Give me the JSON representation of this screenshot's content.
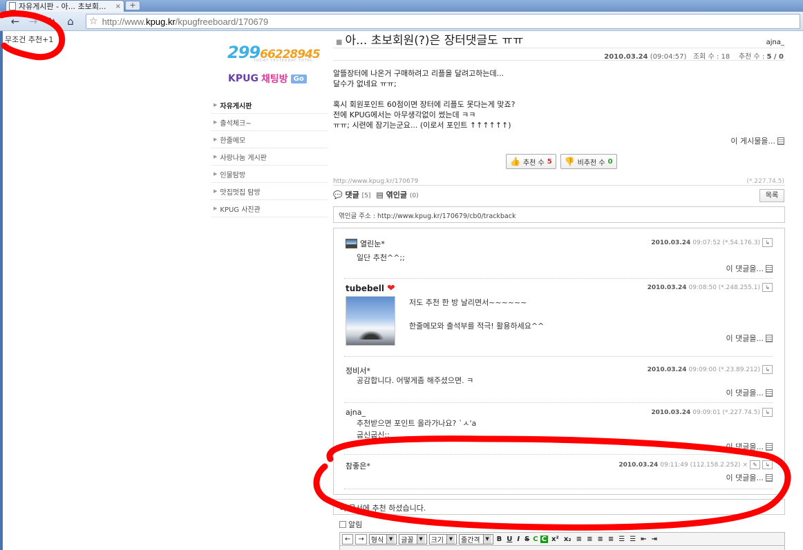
{
  "browser": {
    "tab_title": "자유게시판 - 아... 초보회...",
    "tab_close": "×",
    "new_tab": "+",
    "url_prefix": "http://www.",
    "url_domain": "kpug.kr",
    "url_path": "/kpugfreeboard/170679",
    "back_icon": "←",
    "forward_icon": "→",
    "reload_icon": "↻",
    "home_icon": "⌂",
    "star_icon": "☆"
  },
  "corner_note": "무조건 추천+1",
  "sidebar": {
    "counter_today": "299",
    "counter_rest": "66228945",
    "counter_caption": "TODAY YESTERDAY TOTAL",
    "chat_kpug": "KPUG",
    "chat_room": "채팅방",
    "chat_go": "Go",
    "items": [
      {
        "label": "자유게시판"
      },
      {
        "label": "출석체크~"
      },
      {
        "label": "한줄메모"
      },
      {
        "label": "사랑나눔 게시판"
      },
      {
        "label": "인물탐방"
      },
      {
        "label": "맛집멋집 탐방"
      },
      {
        "label": "KPUG 사진관"
      }
    ]
  },
  "post": {
    "title": "아... 초보회원(?)은 장터댓글도 ㅠㅠ",
    "author": "ajna_",
    "date": "2010.03.24",
    "time": "(09:04:57)",
    "views_label": "조회 수 : ",
    "views": "18",
    "votes_label": "추천 수 : ",
    "votes": "5 / 0",
    "body": [
      "알뜰장터에 나온거 구매하려고 리플을 달려고하는데...",
      "달수가 없네요 ㅠㅠ;",
      "",
      "혹시 회원포인트 60점이면 장터에 리플도 못다는게 맞죠?",
      "전에 KPUG에서는 아무생각없이 썼는데 ㅋㅋ",
      "ㅠㅠ; 시련에 잠기는군요... (이로서 포인트 ↑↑↑↑↑↑)"
    ],
    "more_label": "이 게시물을...",
    "vote_up_label": "추천 수",
    "vote_up_count": "5",
    "vote_down_label": "비추천 수",
    "vote_down_count": "0",
    "permalink": "http://www.kpug.kr/170679",
    "ip": "(*.227.74.5)"
  },
  "comment_tabs": {
    "comments_label": "댓글",
    "comments_count": "[5]",
    "trackback_label": "엮인글",
    "trackback_count": "(0)",
    "list_button": "목록"
  },
  "trackback_url": "엮인글 주소 : http://www.kpug.kr/170679/cb0/trackback",
  "comments": [
    {
      "author": "열린눈*",
      "date": "2010.03.24",
      "meta": "09:07:52 (*.54.176.3)",
      "text": [
        "일단 추천^^;;"
      ],
      "more": "이 댓글을..."
    },
    {
      "author": "tubebell",
      "date": "2010.03.24",
      "meta": "09:08:50 (*.248.255.1)",
      "text": [
        "저도 추천 한 방 날리면서~~~~~~",
        "",
        "한줄메모와 출석부를 적극! 활용하세요^^"
      ],
      "more": "이 댓글을..."
    },
    {
      "author": "정비서*",
      "date": "2010.03.24",
      "meta": "09:09:00 (*.23.89.212)",
      "text": [
        "공감합니다. 어떻게좀 해주셨으면. ㅋ"
      ],
      "more": "이 댓글을..."
    },
    {
      "author": "ajna_",
      "date": "2010.03.24",
      "meta": "09:09:01 (*.227.74.5)",
      "text": [
        "추천받으면 포인트 올라가나요? `ㅅ'a",
        "굽신굽신;;"
      ],
      "more": "이 댓글을..."
    },
    {
      "author": "참좋은*",
      "date": "2010.03.24",
      "meta": "09:11:49 (112.158.2.252)",
      "delete": "×",
      "text": [],
      "more": "이 댓글을..."
    }
  ],
  "notice": "이 문서에 추천 하셨습니다.",
  "notify_label": "알림",
  "editor": {
    "format_label": "형식",
    "font_label": "글꼴",
    "size_label": "크기",
    "line_label": "줄간격",
    "undo": "←",
    "redo": "→",
    "bold": "B",
    "underline": "U",
    "italic": "I",
    "strike": "S",
    "color": "C",
    "bgcolor": "C",
    "sup": "x²",
    "sub": "x₂"
  },
  "colors": {
    "annotation_red": "#ff0000",
    "counter_blue": "#3db0e6",
    "counter_orange": "#f0a023",
    "chrome_blue": "#6d94c8"
  }
}
